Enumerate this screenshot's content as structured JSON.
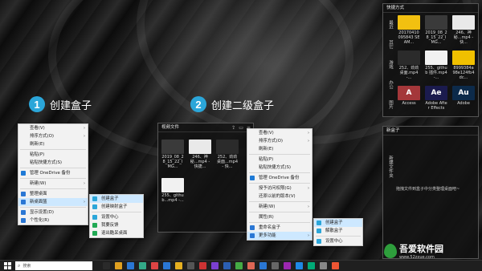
{
  "steps": [
    {
      "num": "1",
      "label": "创建盒子"
    },
    {
      "num": "2",
      "label": "创建二级盒子"
    }
  ],
  "menu1": {
    "items": [
      {
        "label": "查看(V)",
        "arrow": true
      },
      {
        "label": "排序方式(O)",
        "arrow": true
      },
      {
        "label": "刷新(E)"
      },
      {
        "sep": true
      },
      {
        "label": "粘贴(P)"
      },
      {
        "label": "粘贴快捷方式(S)"
      },
      {
        "sep": true
      },
      {
        "label": "管理 OneDrive 备份",
        "icon": "#1e7ad6"
      },
      {
        "sep": true
      },
      {
        "label": "新建(W)",
        "arrow": true
      },
      {
        "sep": true
      },
      {
        "label": "整理桌面",
        "icon": "#2a77d4"
      },
      {
        "label": "新桌面篮",
        "icon": "#2a77d4",
        "arrow": true,
        "selected": true
      },
      {
        "sep": true
      },
      {
        "label": "显示设置(D)",
        "icon": "#2a77d4"
      },
      {
        "label": "个性化(R)",
        "icon": "#2a77d4"
      }
    ]
  },
  "submenu1": {
    "items": [
      {
        "label": "创建盒子",
        "icon": "#2ba6d9",
        "selected": true
      },
      {
        "label": "创建映射盒子",
        "icon": "#2ba6d9"
      },
      {
        "sep": true
      },
      {
        "label": "设置中心",
        "icon": "#2ba6d9"
      },
      {
        "label": "我要反馈",
        "icon": "#22aa55"
      },
      {
        "label": "退出酷呆桌面",
        "icon": "#22aa55"
      }
    ]
  },
  "video_box": {
    "title": "视频文件",
    "files": [
      {
        "name": "2019_08_28_15_22_IMG...",
        "color": "#3a3a3a"
      },
      {
        "name": "246、神秘...mp4 - 快捷...",
        "color": "#e9e9e9"
      },
      {
        "name": "252、劲劲桌面...mp4 - 快...",
        "color": "#2b2b2b"
      },
      {
        "name": "255、github...mp4 -...",
        "color": "#f1f1f1"
      }
    ]
  },
  "menu2": {
    "items": [
      {
        "label": "查看(V)",
        "arrow": true
      },
      {
        "label": "排序方式(O)",
        "arrow": true
      },
      {
        "label": "刷新(E)"
      },
      {
        "sep": true
      },
      {
        "label": "粘贴(P)"
      },
      {
        "label": "粘贴快捷方式(S)"
      },
      {
        "sep": true
      },
      {
        "label": "管理 OneDrive 备份",
        "icon": "#1e7ad6"
      },
      {
        "sep": true
      },
      {
        "label": "授予访问权限(G)",
        "arrow": true
      },
      {
        "label": "还原以前的版本(V)"
      },
      {
        "sep": true
      },
      {
        "label": "新建(W)",
        "arrow": true
      },
      {
        "sep": true
      },
      {
        "label": "属性(R)"
      },
      {
        "sep": true
      },
      {
        "label": "重命名盒子",
        "icon": "#2a77d4"
      },
      {
        "label": "更多功能",
        "icon": "#2a77d4",
        "arrow": true,
        "selected": true
      }
    ]
  },
  "submenu2": {
    "items": [
      {
        "label": "创建盒子",
        "icon": "#2ba6d9",
        "selected": true
      },
      {
        "label": "解散盒子",
        "icon": "#2ba6d9"
      },
      {
        "sep": true
      },
      {
        "label": "设置中心",
        "icon": "#2ba6d9"
      }
    ]
  },
  "shortcut_box": {
    "title": "快捷方式",
    "tabs": [
      "最近",
      "其它",
      "游戏",
      "办公",
      "图片"
    ],
    "files": [
      {
        "name": "20170410095843 SEAM...",
        "color": "#f2c010"
      },
      {
        "name": "2019_08_28_15_22_IMG...",
        "color": "#3a3a3a"
      },
      {
        "name": "246、神秘...mp4 - 快...",
        "color": "#e9e9e9"
      },
      {
        "name": "252、劲劲桌面.mp4 -...",
        "color": "#2b2b2b"
      },
      {
        "name": "255、github 插件.mp4 -...",
        "color": "#f1f1f1"
      },
      {
        "name": "8999384a98e124fb4dc...",
        "color": "#f0c000"
      },
      {
        "name": "Access",
        "color": "#a4373a",
        "glyph": "A"
      },
      {
        "name": "Adobe After Effects",
        "color": "#1b1b4e",
        "glyph": "Ae"
      },
      {
        "name": "Adobe",
        "color": "#0c2a4a",
        "glyph": "Au"
      }
    ]
  },
  "new_box": {
    "title": "新盒子",
    "side": "新建文件夹",
    "hint": "拖拽文件到盒子中分类整理桌面吧~"
  },
  "taskbar": {
    "search_placeholder": "搜索"
  },
  "watermark": {
    "brand": "吾爱软件园",
    "url": "www.52zxue.com"
  }
}
